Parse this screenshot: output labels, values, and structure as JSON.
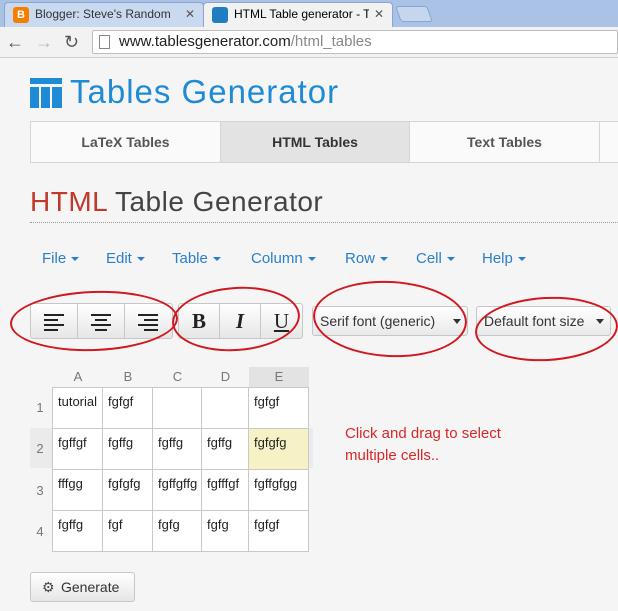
{
  "browser": {
    "tabs": [
      {
        "title": "Blogger: Steve's Random"
      },
      {
        "title": "HTML Table generator - T"
      }
    ],
    "url_domain": "www.tablesgenerator.com",
    "url_path": "/html_tables"
  },
  "site": {
    "logo_text": "Tables Generator",
    "main_tabs": [
      "LaTeX Tables",
      "HTML Tables",
      "Text Tables"
    ],
    "active_tab": "HTML Tables"
  },
  "heading": {
    "part1": "HTML",
    "part2": " Table Generator"
  },
  "menu": [
    "File",
    "Edit",
    "Table",
    "Column",
    "Row",
    "Cell",
    "Help"
  ],
  "format_buttons": {
    "bold": "B",
    "italic": "I",
    "underline": "U"
  },
  "selects": {
    "font": "Serif font (generic)",
    "size": "Default font size"
  },
  "table": {
    "columns": [
      "A",
      "B",
      "C",
      "D",
      "E"
    ],
    "rows": [
      {
        "num": "1",
        "cells": [
          "tutorial",
          "fgfgf",
          "",
          "",
          "fgfgf"
        ]
      },
      {
        "num": "2",
        "cells": [
          "fgffgf",
          "fgffg",
          "fgffg",
          "fgffg",
          "fgfgfg"
        ]
      },
      {
        "num": "3",
        "cells": [
          "fffgg",
          "fgfgfg",
          "fgffgffg",
          "fgfffgf",
          "fgffgfgg"
        ]
      },
      {
        "num": "4",
        "cells": [
          "fgffg",
          "fgf",
          "fgfg",
          "fgfg",
          "fgfgf"
        ]
      }
    ],
    "selected_cell": "E2"
  },
  "hint": {
    "line1": "Click and drag to select",
    "line2": "multiple cells.."
  },
  "generate_label": "Generate",
  "annotation_color": "#d0191e",
  "accent_color": "#1f8bd6"
}
